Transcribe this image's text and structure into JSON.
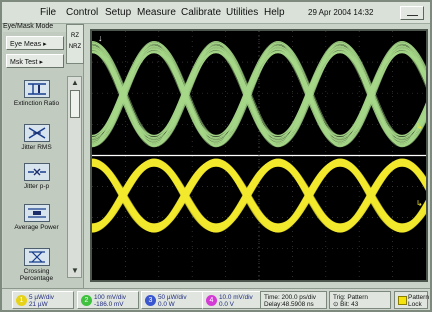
{
  "menubar": {
    "items": [
      "File",
      "Control",
      "Setup",
      "Measure",
      "Calibrate",
      "Utilities",
      "Help"
    ],
    "datetime": "29 Apr 2004  14:32"
  },
  "panel": {
    "mode_label": "Eye/Mask Mode",
    "eye_meas": "Eye Meas",
    "mask_test": "Msk Test",
    "nrz_labels": [
      "RZ",
      "NRZ"
    ],
    "tools": [
      {
        "label": "Extinction Ratio",
        "icon": "extinction-ratio-icon"
      },
      {
        "label": "Jitter RMS",
        "icon": "jitter-rms-icon"
      },
      {
        "label": "Jitter p-p",
        "icon": "jitter-pp-icon"
      },
      {
        "label": "Average Power",
        "icon": "average-power-icon"
      },
      {
        "label": "Crossing Percentage",
        "icon": "crossing-percentage-icon"
      }
    ]
  },
  "status": {
    "channels": [
      {
        "num": "1",
        "line1": "5 µW/div",
        "line2": "21 µW",
        "color": "#e7d21a"
      },
      {
        "num": "2",
        "line1": "100 mV/div",
        "line2": "-186.0 mV",
        "color": "#3ec13c"
      },
      {
        "num": "3",
        "line1": "50 µW/div",
        "line2": "0.0 W",
        "color": "#3a57d0"
      },
      {
        "num": "4",
        "line1": "10.0 mV/div",
        "line2": "0.0 V",
        "color": "#d43bd5"
      }
    ],
    "time_line1": "Time: 200.0 ps/div",
    "time_line2": "Delay:48.5908 ns",
    "trig_line1": "Trig: Pattern",
    "trig_line2": "Bit: 43",
    "pattern_lock": "Pattern Lock"
  },
  "colors": {
    "trace_green": "#a8d98a",
    "trace_yellow": "#f2ea2e",
    "screen_bg": "#000000"
  }
}
